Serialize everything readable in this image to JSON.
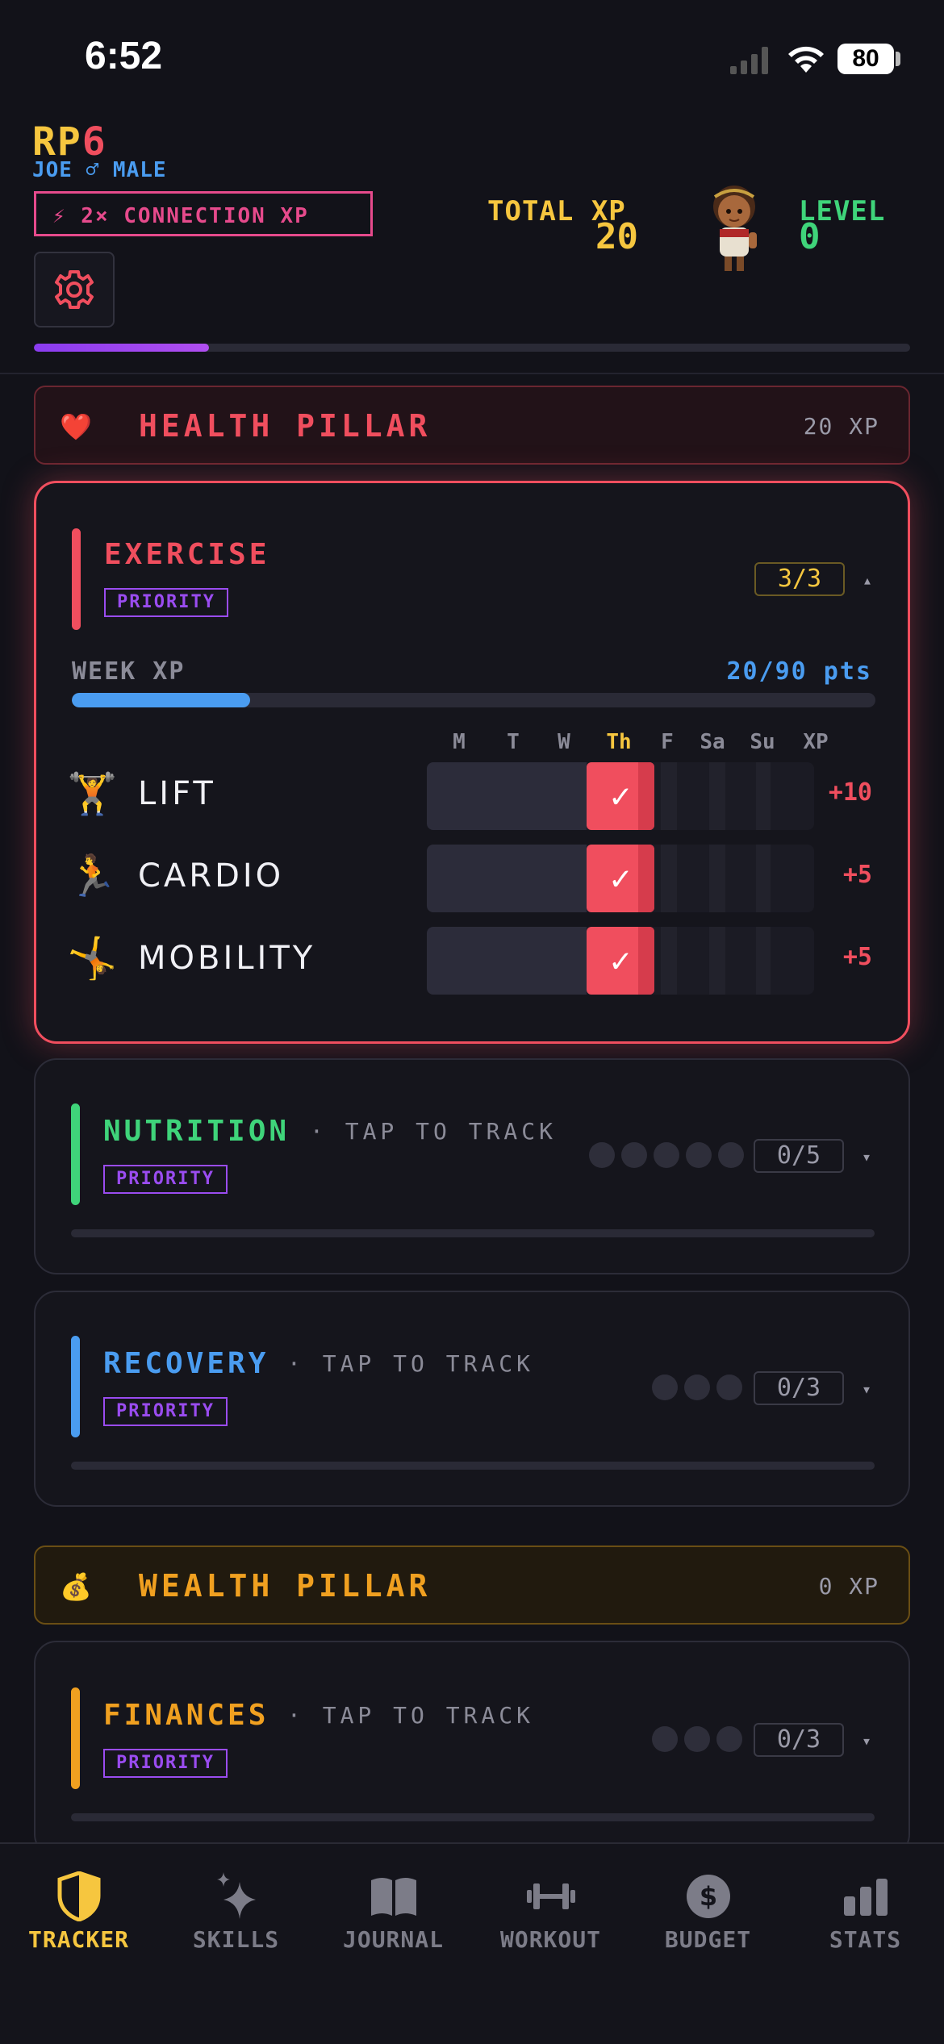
{
  "status_bar": {
    "time": "6:52",
    "battery": "80"
  },
  "header": {
    "logo_a": "RP",
    "logo_b": "6",
    "user": "JOE ♂ MALE",
    "connection_badge": "⚡ 2× CONNECTION XP",
    "total_xp_label": "TOTAL XP",
    "total_xp_value": "20",
    "level_label": "LEVEL",
    "level_value": "0",
    "xp_progress": 0.2
  },
  "health_pillar": {
    "icon": "❤️",
    "name": "HEALTH PILLAR",
    "xp": "20 XP"
  },
  "exercise": {
    "title": "EXERCISE",
    "priority": "PRIORITY",
    "count": "3/3",
    "chevron": "▴",
    "week_label": "WEEK XP",
    "week_points": "20/90 pts",
    "week_progress": 0.222,
    "days": [
      "M",
      "T",
      "W",
      "Th",
      "F",
      "Sa",
      "Su",
      "XP"
    ],
    "rows": [
      {
        "icon": "🏋️",
        "name": "LIFT",
        "check": "✓",
        "xp": "+10"
      },
      {
        "icon": "🏃",
        "name": "CARDIO",
        "check": "✓",
        "xp": "+5"
      },
      {
        "icon": "🤸",
        "name": "MOBILITY",
        "check": "✓",
        "xp": "+5"
      }
    ]
  },
  "nutrition": {
    "title": "NUTRITION",
    "tap": "· TAP TO TRACK",
    "priority": "PRIORITY",
    "count": "0/5",
    "chevron": "▾"
  },
  "recovery": {
    "title": "RECOVERY",
    "tap": "· TAP TO TRACK",
    "priority": "PRIORITY",
    "count": "0/3",
    "chevron": "▾"
  },
  "wealth_pillar": {
    "icon": "💰",
    "name": "WEALTH PILLAR",
    "xp": "0 XP"
  },
  "finances": {
    "title": "FINANCES",
    "tap": "· TAP TO TRACK",
    "priority": "PRIORITY",
    "count": "0/3",
    "chevron": "▾"
  },
  "nav": {
    "tracker": "TRACKER",
    "skills": "SKILLS",
    "journal": "JOURNAL",
    "workout": "WORKOUT",
    "budget": "BUDGET",
    "stats": "STATS"
  },
  "colors": {
    "accent_red": "#f04e5e",
    "gold": "#f6c63f",
    "green": "#3fd47a",
    "blue": "#4a9cf0",
    "purple": "#9a4cf0",
    "orange": "#f0a020"
  }
}
